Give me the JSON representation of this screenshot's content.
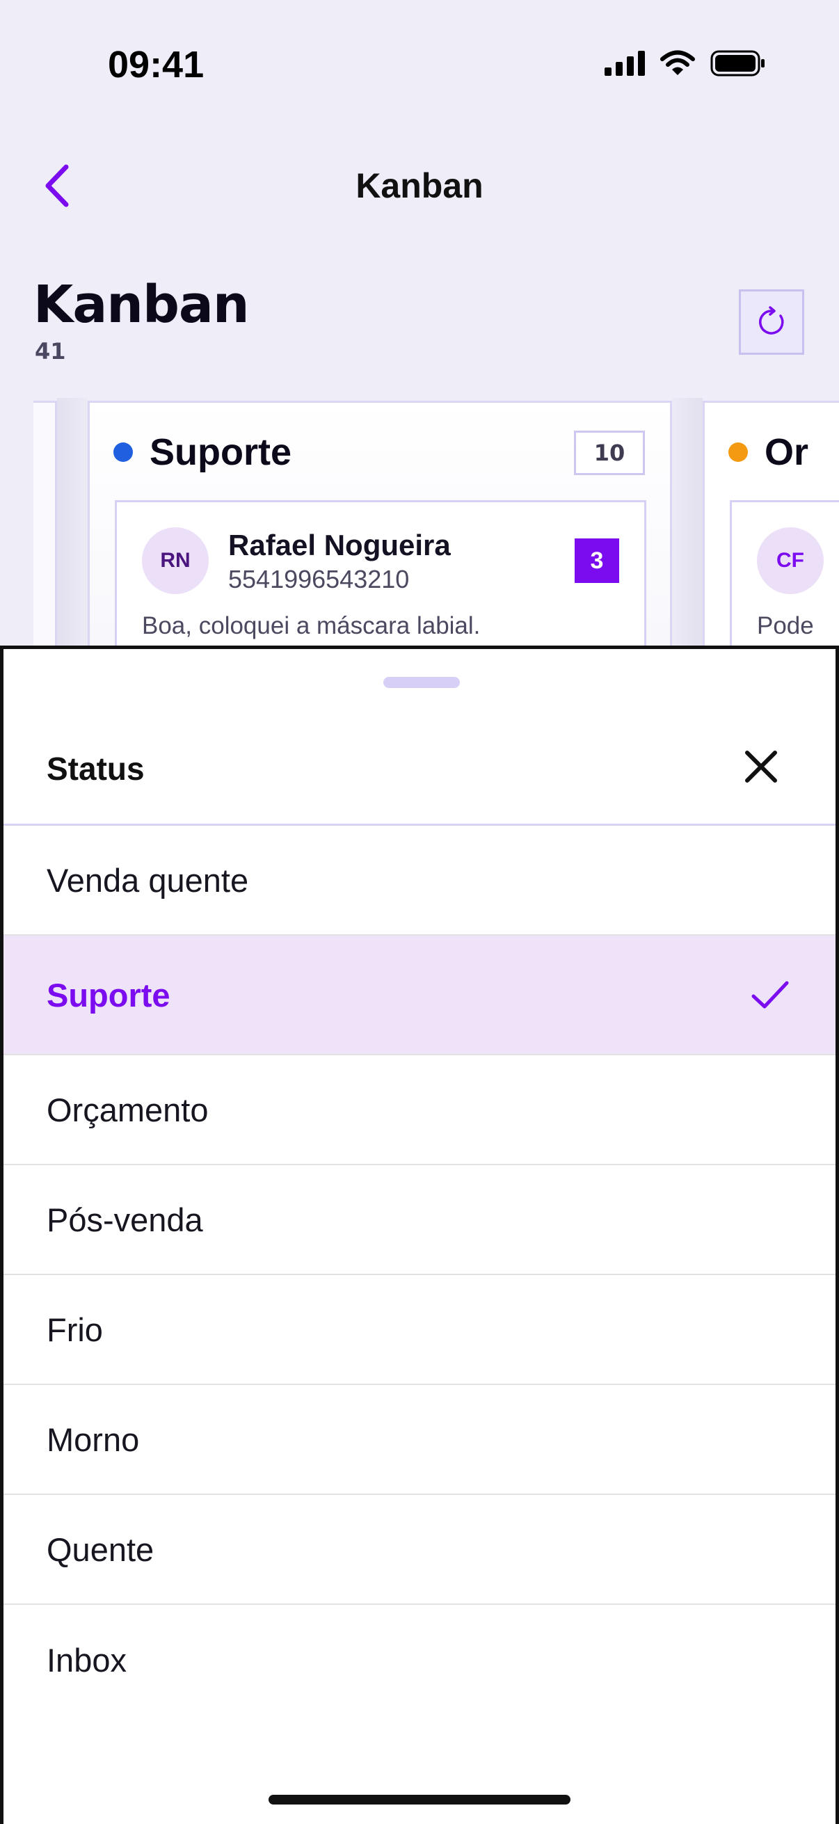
{
  "status_bar": {
    "time": "09:41"
  },
  "nav": {
    "title": "Kanban"
  },
  "header": {
    "title": "Kanban",
    "count": "41"
  },
  "columns": [
    {
      "title": "Suporte",
      "count": "10",
      "dot_color": "#1f5fe0",
      "card": {
        "initials": "RN",
        "name": "Rafael Nogueira",
        "phone": "5541996543210",
        "badge": "3",
        "preview": "Boa, coloquei a máscara labial."
      }
    },
    {
      "title": "Or",
      "dot_color": "#f39a12",
      "card": {
        "initials": "CF",
        "preview": "Pode"
      }
    }
  ],
  "sheet": {
    "title": "Status",
    "options": [
      {
        "label": "Venda quente"
      },
      {
        "label": "Suporte",
        "selected": true
      },
      {
        "label": "Orçamento"
      },
      {
        "label": "Pós-venda"
      },
      {
        "label": "Frio"
      },
      {
        "label": "Morno"
      },
      {
        "label": "Quente"
      },
      {
        "label": "Inbox"
      }
    ]
  },
  "colors": {
    "accent": "#7b0cf0",
    "selected_bg": "#efe3fa"
  }
}
